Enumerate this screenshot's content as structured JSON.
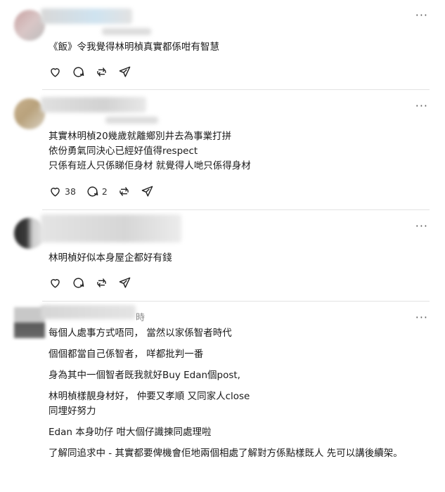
{
  "more_label": "···",
  "posts": [
    {
      "lines": [
        "《飯》令我覺得林明楨真實都係咁有智慧"
      ],
      "likes": "",
      "replies": ""
    },
    {
      "lines": [
        "其實林明楨20幾歲就離鄉別井去為事業打拼",
        "依份勇氣同決心已經好值得respect",
        "只係有班人只係睇佢身材 就覺得人哋只係得身材"
      ],
      "likes": "38",
      "replies": "2"
    },
    {
      "lines": [
        "林明楨好似本身屋企都好有錢"
      ],
      "likes": "",
      "replies": ""
    },
    {
      "header_suffix": "時",
      "paragraphs": [
        "每個人處事方式唔同， 當然以家係智者時代",
        "個個都當自己係智者， 咩都批判一番",
        "身為其中一個智者既我就好Buy Edan個post,",
        "林明楨樣靚身材好， 仲要又孝順 又同家人close\n同埋好努力",
        "Edan 本身叻仔 咁大個仔識揀同處理啦",
        "了解同追求中 - 其實都要俾機會佢地兩個相處了解對方係點樣既人 先可以講後續架。"
      ]
    }
  ],
  "icons": [
    "heart-icon",
    "comment-icon",
    "repost-icon",
    "share-icon"
  ]
}
